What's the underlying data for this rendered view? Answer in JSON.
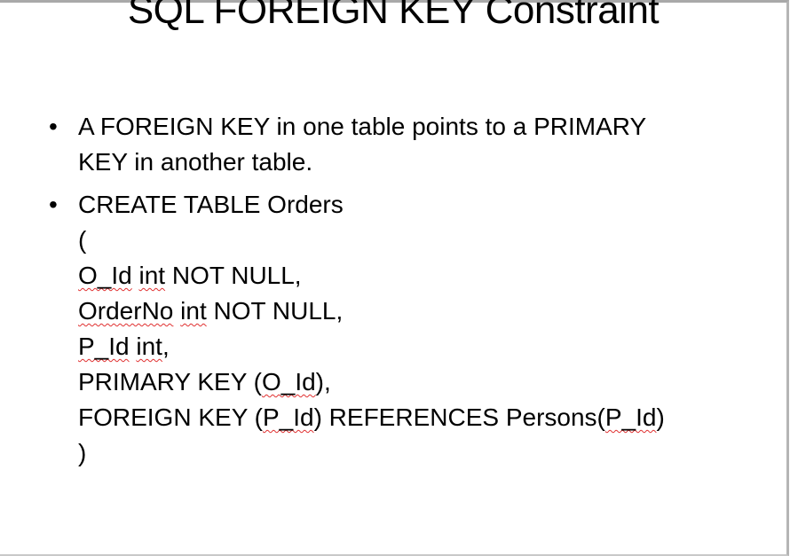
{
  "slide": {
    "title": "SQL FOREIGN KEY Constraint",
    "bullet_char": "•",
    "bullet1": {
      "lines": [
        "A FOREIGN KEY in one table points to a PRIMARY",
        "KEY in another table."
      ]
    },
    "bullet2": {
      "lines": [
        [
          {
            "t": "CREATE TABLE Orders"
          }
        ],
        [
          {
            "t": "("
          }
        ],
        [
          {
            "t": "O_Id",
            "sq": true
          },
          {
            "t": " "
          },
          {
            "t": "int",
            "sq": true
          },
          {
            "t": " NOT NULL,"
          }
        ],
        [
          {
            "t": "OrderNo",
            "sq": true
          },
          {
            "t": " "
          },
          {
            "t": "int",
            "sq": true
          },
          {
            "t": " NOT NULL,"
          }
        ],
        [
          {
            "t": "P_Id",
            "sq": true
          },
          {
            "t": " "
          },
          {
            "t": "int",
            "sq": true
          },
          {
            "t": ","
          }
        ],
        [
          {
            "t": "PRIMARY KEY ("
          },
          {
            "t": "O_Id",
            "sq": true
          },
          {
            "t": "),"
          }
        ],
        [
          {
            "t": "FOREIGN KEY ("
          },
          {
            "t": "P_Id",
            "sq": true
          },
          {
            "t": ") REFERENCES Persons("
          },
          {
            "t": "P_Id",
            "sq": true
          },
          {
            "t": ")"
          }
        ],
        [
          {
            "t": ")"
          }
        ]
      ]
    }
  }
}
